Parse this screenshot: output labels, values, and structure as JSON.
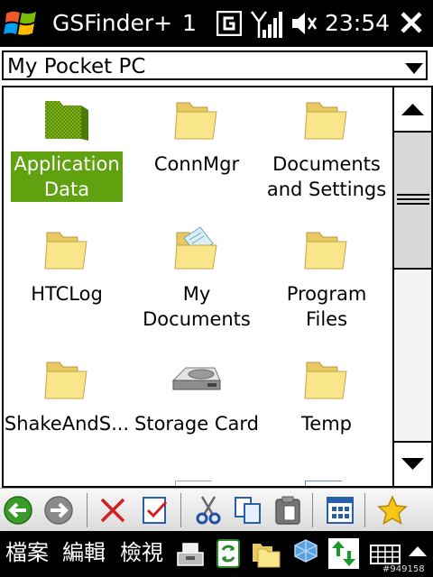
{
  "titlebar": {
    "app_title": "GSFinder+",
    "notification_count": "1",
    "time": "23:54",
    "icons": [
      "windows-start-icon",
      "g-app-icon",
      "signal-strength-icon",
      "speaker-muted-icon",
      "close-icon"
    ]
  },
  "location": {
    "value": "My Pocket PC",
    "dropdown_icon": "chevron-down-icon"
  },
  "files": [
    {
      "label": "Application\nData",
      "icon": "folder-icon",
      "selected": true
    },
    {
      "label": "ConnMgr",
      "icon": "folder-icon",
      "selected": false
    },
    {
      "label": "Documents\nand Settings",
      "icon": "folder-icon",
      "selected": false
    },
    {
      "label": "HTCLog",
      "icon": "folder-icon",
      "selected": false
    },
    {
      "label": "My\nDocuments",
      "icon": "my-documents-folder-icon",
      "selected": false
    },
    {
      "label": "Program Files",
      "icon": "folder-icon",
      "selected": false
    },
    {
      "label": "ShakeAndS...",
      "icon": "folder-icon",
      "selected": false
    },
    {
      "label": "Storage Card",
      "icon": "storage-card-icon",
      "selected": false
    },
    {
      "label": "Temp",
      "icon": "folder-icon",
      "selected": false
    }
  ],
  "toolbar": {
    "buttons": [
      "back-icon",
      "forward-icon",
      "delete-icon",
      "select-icon",
      "cut-icon",
      "copy-icon",
      "paste-icon",
      "view-icon",
      "favorites-icon"
    ]
  },
  "menubar": {
    "menu1": "檔案",
    "menu2": "編輯",
    "menu3": "檢視",
    "buttons": [
      "inbox-icon",
      "refresh-icon",
      "folders-icon",
      "network-icon",
      "sync-icon",
      "keyboard-icon",
      "menu-up-icon"
    ]
  },
  "watermark": "#949158",
  "colors": {
    "selection": "#5fa10e",
    "folder_yellow": "#f7e27e",
    "bar_background": "#000000"
  }
}
